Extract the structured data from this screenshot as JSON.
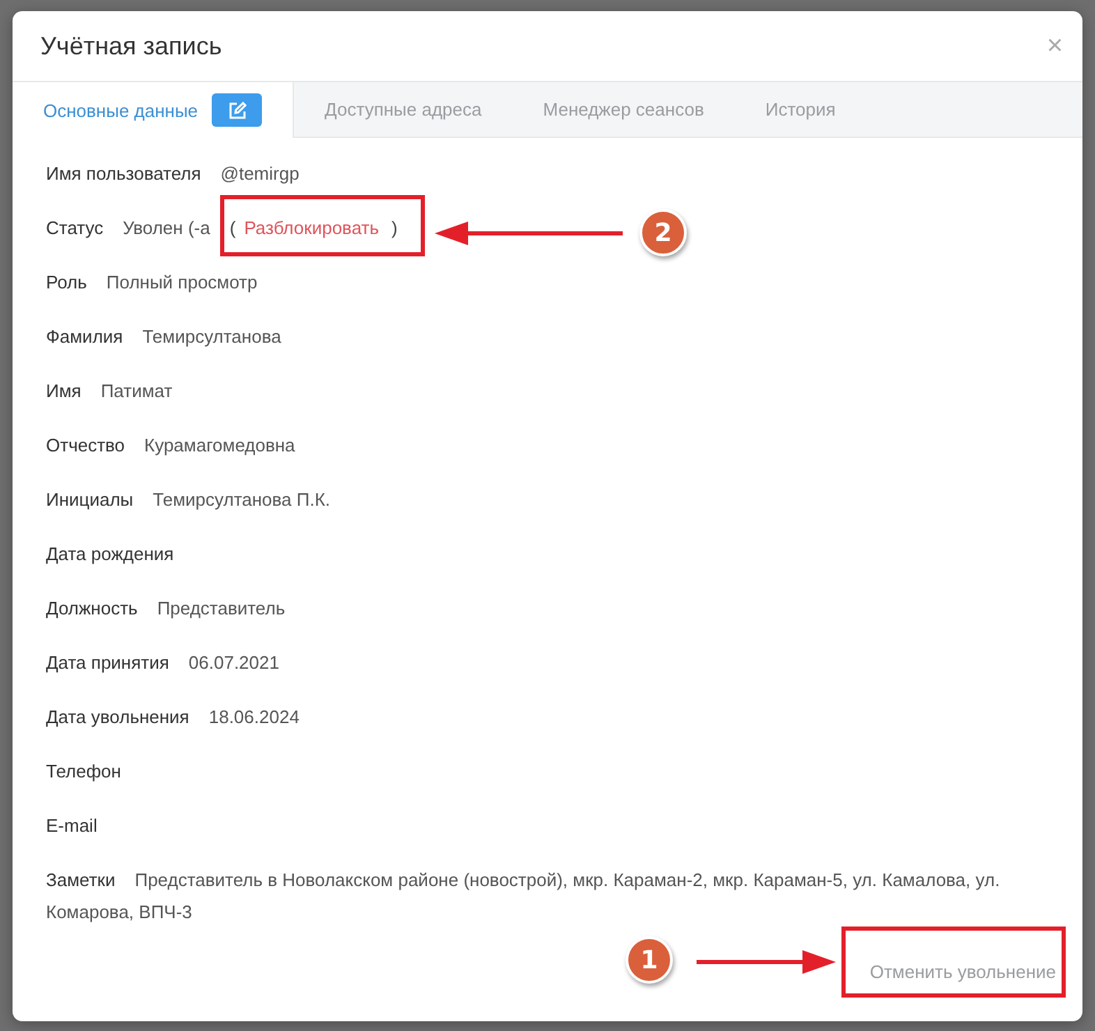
{
  "dialog": {
    "title": "Учётная запись",
    "close": "×"
  },
  "tabs": [
    {
      "label": "Основные данные",
      "selected": true,
      "editable": true
    },
    {
      "label": "Доступные адреса",
      "selected": false
    },
    {
      "label": "Менеджер сеансов",
      "selected": false
    },
    {
      "label": "История",
      "selected": false
    }
  ],
  "fields": [
    {
      "kind": "text",
      "label": "Имя пользователя",
      "value": "@temirgp"
    },
    {
      "kind": "status",
      "label": "Статус",
      "value": "Уволен (-а",
      "action_open": "(",
      "action": "Разблокировать",
      "action_close": ")"
    },
    {
      "kind": "text",
      "label": "Роль",
      "value": "Полный просмотр"
    },
    {
      "kind": "text",
      "label": "Фамилия",
      "value": "Темирсултанова"
    },
    {
      "kind": "text",
      "label": "Имя",
      "value": "Патимат"
    },
    {
      "kind": "text",
      "label": "Отчество",
      "value": "Курамагомедовна"
    },
    {
      "kind": "text",
      "label": "Инициалы",
      "value": "Темирсултанова П.К."
    },
    {
      "kind": "text",
      "label": "Дата рождения"
    },
    {
      "kind": "text",
      "label": "Должность",
      "value": "Представитель"
    },
    {
      "kind": "text",
      "label": "Дата принятия",
      "value": "06.07.2021"
    },
    {
      "kind": "text",
      "label": "Дата увольнения",
      "value": "18.06.2024"
    },
    {
      "kind": "text",
      "label": "Телефон"
    },
    {
      "kind": "text",
      "label": "E-mail"
    },
    {
      "kind": "notes",
      "label": "Заметки",
      "value": "Представитель в Новолакском районе (новострой), мкр. Караман-2, мкр. Караман-5, ул. Камалова, ул. Комарова, ВПЧ-3"
    }
  ],
  "footer": {
    "button": "Отменить увольнение"
  },
  "annotations": [
    {
      "number": "1"
    },
    {
      "number": "2"
    }
  ]
}
